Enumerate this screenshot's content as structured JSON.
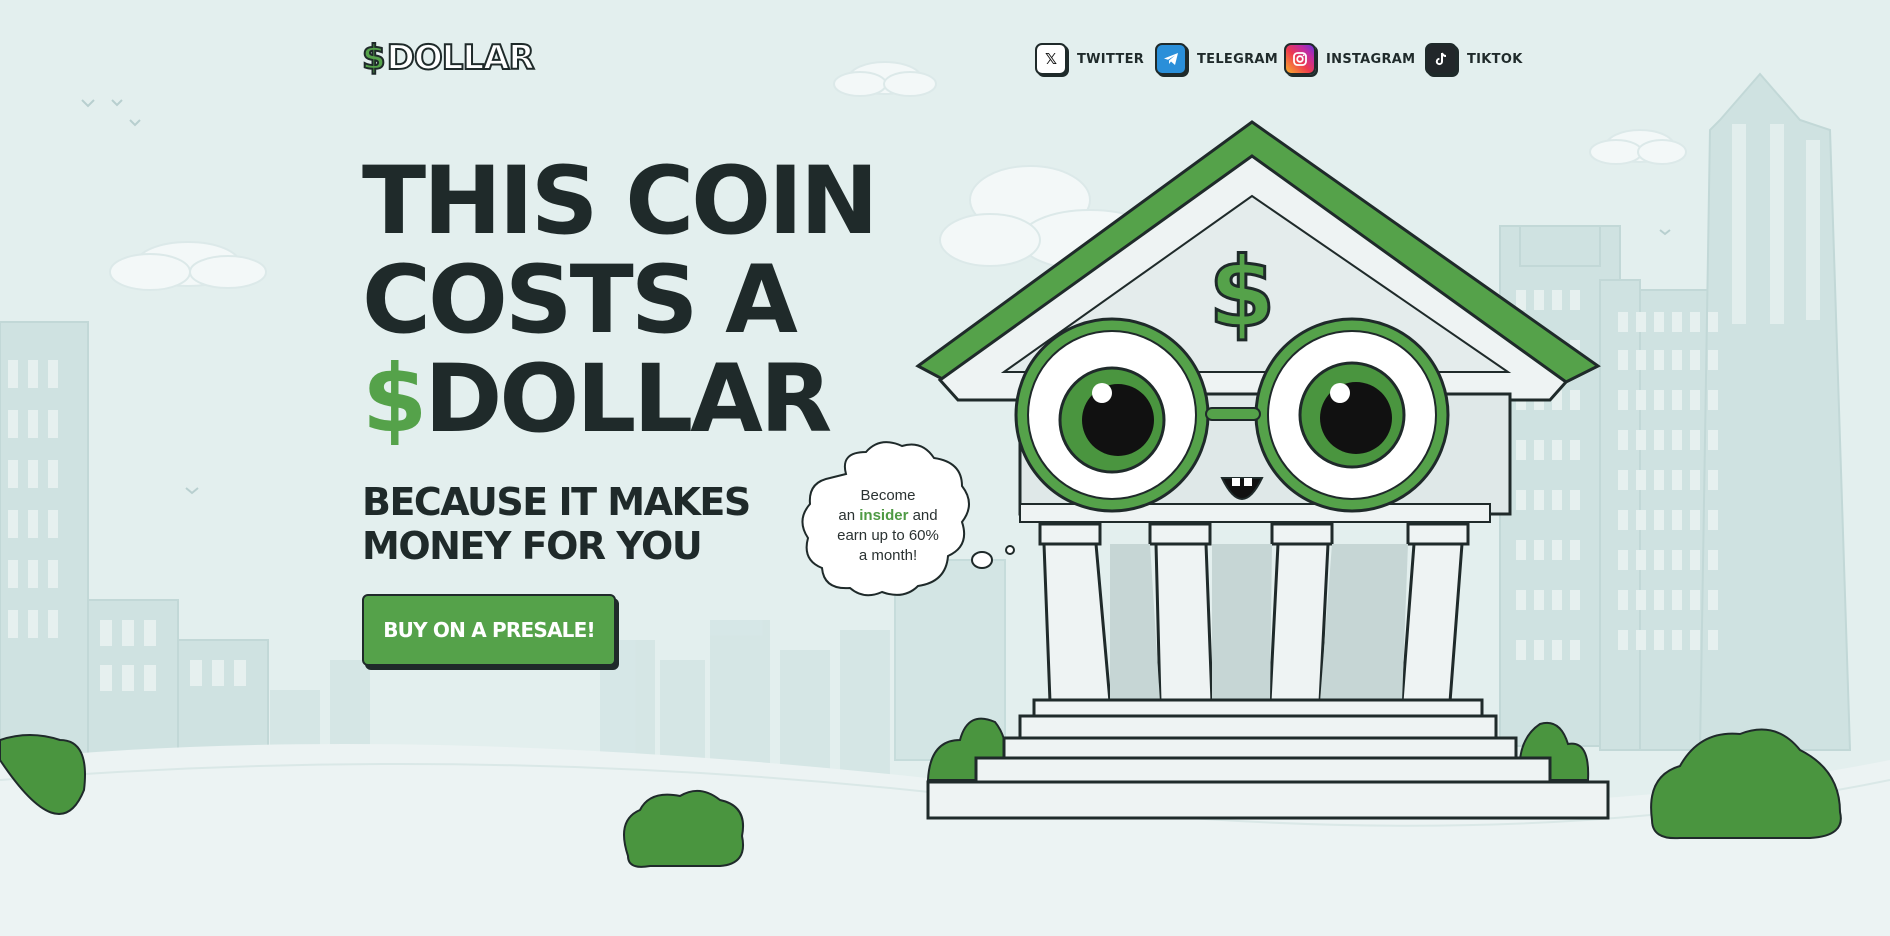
{
  "brand": {
    "logo_text": "DOLLAR",
    "logo_prefix": "$"
  },
  "nav": {
    "socials": [
      {
        "label": "TWITTER",
        "icon": "x-icon"
      },
      {
        "label": "TELEGRAM",
        "icon": "telegram-icon"
      },
      {
        "label": "INSTAGRAM",
        "icon": "instagram-icon"
      },
      {
        "label": "TIKTOK",
        "icon": "tiktok-icon"
      }
    ]
  },
  "hero": {
    "headline_line1": "THIS COIN",
    "headline_line2": "COSTS A",
    "headline_line3_prefix": "$",
    "headline_line3_rest": "DOLLAR",
    "subheadline_line1": "BECAUSE IT MAKES",
    "subheadline_line2": "MONEY FOR YOU",
    "cta_label": "BUY ON A PRESALE!"
  },
  "bubble": {
    "line1": "Become",
    "line2_pre": "an",
    "line2_highlight": "insider",
    "line2_post": "and",
    "line3": "earn up to 60%",
    "line4": "a month!"
  },
  "mascot": {
    "pediment_symbol": "$"
  },
  "colors": {
    "background": "#e3efee",
    "accent_green": "#55a24a",
    "dark_text": "#1f2a2a"
  }
}
